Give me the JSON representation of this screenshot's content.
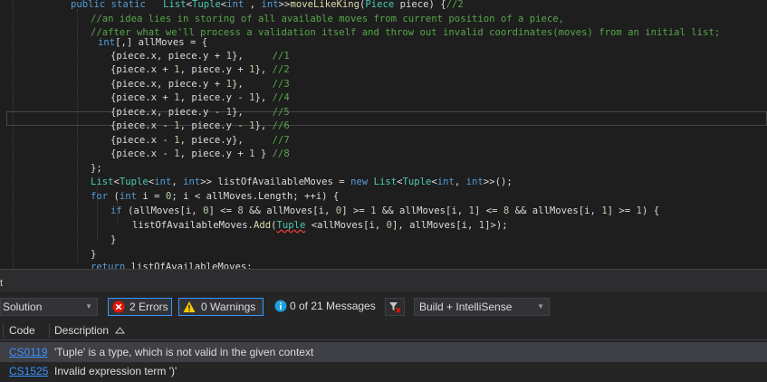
{
  "editor": {
    "lines": [
      [
        [
          "kw",
          "public static "
        ],
        [
          "",
          "  "
        ],
        [
          "ty",
          "List"
        ],
        [
          "",
          "<"
        ],
        [
          "ty",
          "Tuple"
        ],
        [
          "",
          "<"
        ],
        [
          "kw",
          "int"
        ],
        [
          "",
          " , "
        ],
        [
          "kw",
          "int"
        ],
        [
          "",
          ">>"
        ],
        [
          "mt",
          "moveLikeKing"
        ],
        [
          "",
          "("
        ],
        [
          "ty",
          "Piece"
        ],
        [
          "",
          " piece) {"
        ],
        [
          "cm",
          "//2"
        ]
      ],
      [
        [
          "cm",
          "//an idea lies in storing of all available moves from current position of a piece,"
        ]
      ],
      [
        [
          "cm",
          "//after what we'll process a validation itself and throw out invalid coordinates(moves) from an initial list;"
        ]
      ],
      [
        [
          "kw",
          "int"
        ],
        [
          "",
          "[,] allMoves = {"
        ]
      ],
      [
        [
          "",
          "{piece.x, piece.y + "
        ],
        [
          "nm",
          "1"
        ],
        [
          "",
          "},     "
        ],
        [
          "cm",
          "//1"
        ]
      ],
      [
        [
          "",
          "{piece.x + "
        ],
        [
          "nm",
          "1"
        ],
        [
          "",
          ", piece.y + "
        ],
        [
          "nm",
          "1"
        ],
        [
          "",
          "}, "
        ],
        [
          "cm",
          "//2"
        ]
      ],
      [
        [
          "",
          "{piece.x, piece.y + "
        ],
        [
          "nm",
          "1"
        ],
        [
          "",
          "},     "
        ],
        [
          "cm",
          "//3"
        ]
      ],
      [
        [
          "",
          "{piece.x + "
        ],
        [
          "nm",
          "1"
        ],
        [
          "",
          ", piece.y - "
        ],
        [
          "nm",
          "1"
        ],
        [
          "",
          "}, "
        ],
        [
          "cm",
          "//4"
        ]
      ],
      [
        [
          "",
          "{piece.x, piece.y - "
        ],
        [
          "nm",
          "1"
        ],
        [
          "",
          "},     "
        ],
        [
          "cm",
          "//5"
        ]
      ],
      [
        [
          "",
          "{piece.x - "
        ],
        [
          "nm",
          "1"
        ],
        [
          "",
          ", piece.y - "
        ],
        [
          "nm",
          "1"
        ],
        [
          "",
          "}, "
        ],
        [
          "cm",
          "//6"
        ]
      ],
      [
        [
          "",
          "{piece.x - "
        ],
        [
          "nm",
          "1"
        ],
        [
          "",
          ", piece.y},     "
        ],
        [
          "cm",
          "//7"
        ]
      ],
      [
        [
          "",
          "{piece.x - "
        ],
        [
          "nm",
          "1"
        ],
        [
          "",
          ", piece.y + "
        ],
        [
          "nm",
          "1"
        ],
        [
          "",
          " } "
        ],
        [
          "cm",
          "//8"
        ]
      ],
      [
        [
          "",
          "};"
        ]
      ],
      [
        [
          "ty",
          "List"
        ],
        [
          "",
          "<"
        ],
        [
          "ty",
          "Tuple"
        ],
        [
          "",
          "<"
        ],
        [
          "kw",
          "int"
        ],
        [
          "",
          ", "
        ],
        [
          "kw",
          "int"
        ],
        [
          "",
          ">> listOfAvailableMoves = "
        ],
        [
          "kw",
          "new "
        ],
        [
          "ty",
          "List"
        ],
        [
          "",
          "<"
        ],
        [
          "ty",
          "Tuple"
        ],
        [
          "",
          "<"
        ],
        [
          "kw",
          "int"
        ],
        [
          "",
          ", "
        ],
        [
          "kw",
          "int"
        ],
        [
          "",
          ">>();"
        ]
      ],
      [
        [
          "kw",
          "for "
        ],
        [
          "",
          "("
        ],
        [
          "kw",
          "int"
        ],
        [
          "",
          " i = "
        ],
        [
          "nm",
          "0"
        ],
        [
          "",
          "; i < allMoves.Length; ++i) {"
        ]
      ],
      [
        [
          "kw",
          "if "
        ],
        [
          "",
          "(allMoves[i, "
        ],
        [
          "nm",
          "0"
        ],
        [
          "",
          "] <= "
        ],
        [
          "nm",
          "8"
        ],
        [
          "",
          " && allMoves[i, "
        ],
        [
          "nm",
          "0"
        ],
        [
          "",
          "] >= "
        ],
        [
          "nm",
          "1"
        ],
        [
          "",
          " && allMoves[i, "
        ],
        [
          "nm",
          "1"
        ],
        [
          "",
          "] <= "
        ],
        [
          "nm",
          "8"
        ],
        [
          "",
          " && allMoves[i, "
        ],
        [
          "nm",
          "1"
        ],
        [
          "",
          "] >= "
        ],
        [
          "nm",
          "1"
        ],
        [
          "",
          ") {"
        ]
      ],
      [
        [
          "",
          "listOfAvailableMoves."
        ],
        [
          "mt",
          "Add"
        ],
        [
          "",
          "("
        ],
        [
          "ty err",
          "Tuple"
        ],
        [
          "",
          " <allMoves[i, "
        ],
        [
          "nm",
          "0"
        ],
        [
          "",
          "], allMoves[i, "
        ],
        [
          "nm",
          "1"
        ],
        [
          "",
          "]>);"
        ]
      ],
      [
        [
          "",
          "}"
        ]
      ],
      [
        [
          "",
          "}"
        ]
      ],
      [
        [
          "kw",
          "return "
        ],
        [
          "",
          "listOfAvailableMoves;"
        ]
      ],
      [
        [
          "",
          "}"
        ]
      ]
    ]
  },
  "panel": {
    "title": "t",
    "scope": "Solution",
    "errors": "2 Errors",
    "warnings": "0 Warnings",
    "messages": "0 of 21 Messages",
    "build": "Build + IntelliSense",
    "columns": {
      "code": "Code",
      "description": "Description"
    },
    "rows": [
      {
        "code": "CS0119",
        "description": "'Tuple' is a type, which is not valid in the given context"
      },
      {
        "code": "CS1525",
        "description": "Invalid expression term ')'"
      }
    ]
  },
  "colors": {
    "error": "#e51400",
    "warning": "#ffcc00",
    "info": "#1ba1e2",
    "accent": "#3399ff"
  }
}
